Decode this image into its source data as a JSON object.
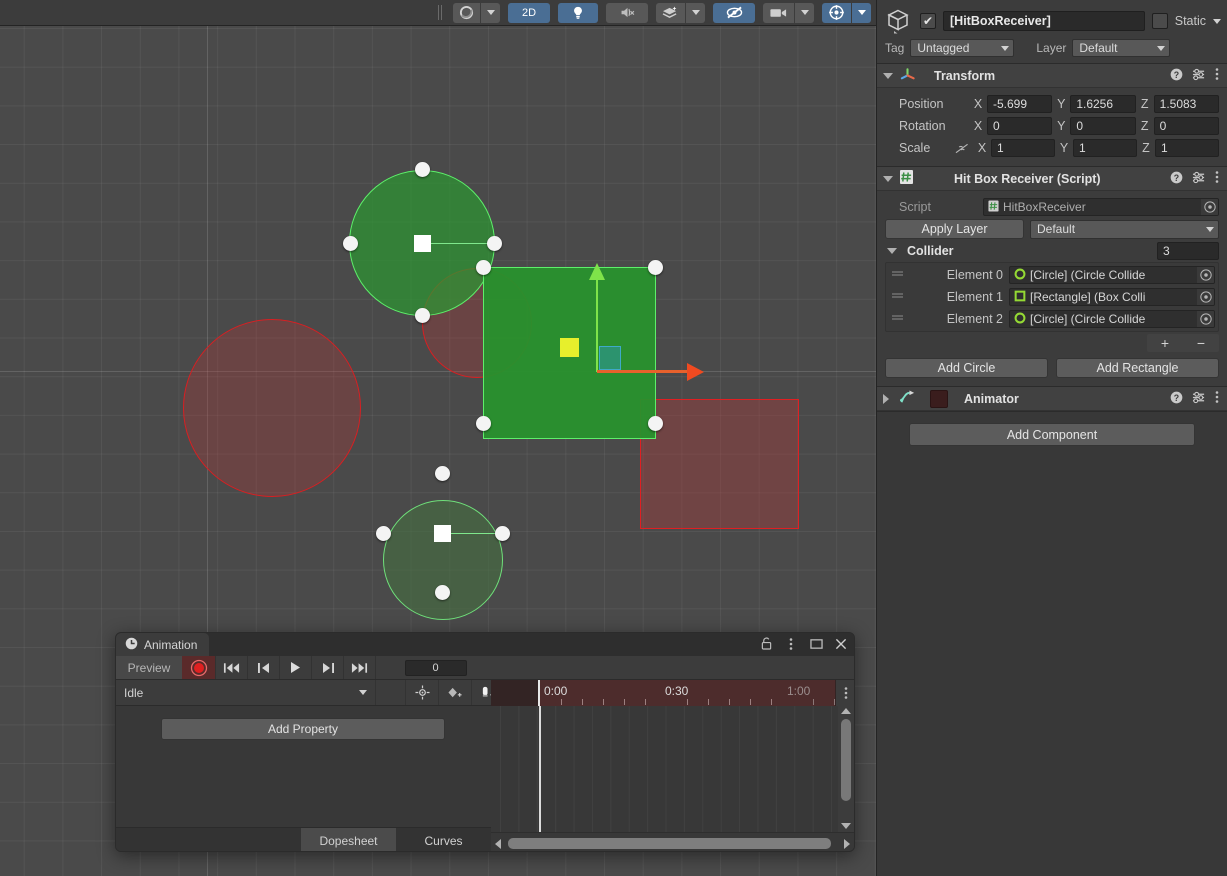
{
  "scene": {
    "toolbar": {
      "draw_mode_label": "",
      "two_d_label": "2D",
      "lighting_icon": "lightbulb-icon",
      "audio_icon": "audio-mute-icon",
      "fx_icon": "effects-icon",
      "hidden_objects_icon": "hidden-objects-icon",
      "camera_icon": "scene-camera-icon",
      "gizmos_icon": "gizmos-icon",
      "shading_icon": "shading-mode-icon"
    },
    "shapes": [
      {
        "name": "circle-collider-top",
        "type": "circle",
        "state": "selected-green"
      },
      {
        "name": "circle-collider-overlap-red",
        "type": "circle",
        "state": "red"
      },
      {
        "name": "rectangle-collider-green",
        "type": "rect",
        "state": "selected-green"
      },
      {
        "name": "circle-collider-left-red",
        "type": "circle",
        "state": "red"
      },
      {
        "name": "circle-collider-bottom",
        "type": "circle",
        "state": "green-dim"
      },
      {
        "name": "rectangle-collider-red",
        "type": "rect",
        "state": "red"
      }
    ]
  },
  "animation": {
    "tab_label": "Animation",
    "tab_icon": "clock-icon",
    "window_icons": [
      "lock-icon",
      "kebab-menu-icon",
      "maximize-icon",
      "close-icon"
    ],
    "preview_label": "Preview",
    "record_icon": "record-icon",
    "transport": [
      "skip-to-start-icon",
      "prev-keyframe-icon",
      "play-icon",
      "next-keyframe-icon",
      "skip-to-end-icon"
    ],
    "frame_value": "0",
    "clip_name": "Idle",
    "row2_buttons": [
      "add-event-icon",
      "add-keyframe-icon",
      "add-keyframe-marker-icon"
    ],
    "add_property_label": "Add Property",
    "bottom_tabs": [
      {
        "label": "Dopesheet",
        "active": true
      },
      {
        "label": "Curves",
        "active": false
      }
    ],
    "timeline_ticks": [
      "0:00",
      "0:30",
      "1:00"
    ],
    "kebab_icon": "timeline-menu-icon",
    "scroll_up_icon": "scroll-up-arrow",
    "scroll_down_icon": "scroll-down-arrow",
    "scroll_left_icon": "scroll-left-arrow",
    "scroll_right_icon": "scroll-right-arrow"
  },
  "inspector": {
    "gameobject": {
      "icon": "cube-icon",
      "enabled": true,
      "check_glyph": "✔",
      "name": "[HitBoxReceiver]",
      "static_label": "Static",
      "tag_label": "Tag",
      "tag_value": "Untagged",
      "layer_label": "Layer",
      "layer_value": "Default"
    },
    "components": [
      {
        "name": "transform",
        "icon": "transform-axis-icon",
        "title": "Transform",
        "expanded": true,
        "header_icons": [
          "help-icon",
          "preset-icon",
          "kebab-menu-icon"
        ],
        "rows": [
          {
            "label": "Position",
            "x": "-5.699",
            "y": "1.6256",
            "z": "1.5083"
          },
          {
            "label": "Rotation",
            "x": "0",
            "y": "0",
            "z": "0"
          },
          {
            "label": "Scale",
            "x": "1",
            "y": "1",
            "z": "1",
            "link_icon": "constrain-proportions-off-icon"
          }
        ],
        "axis_labels": [
          "X",
          "Y",
          "Z"
        ]
      },
      {
        "name": "hit-box-receiver-script",
        "icon": "script-icon",
        "title": "Hit Box Receiver (Script)",
        "expanded": true,
        "header_icons": [
          "help-icon",
          "preset-icon",
          "kebab-menu-icon"
        ],
        "script_label": "Script",
        "script_value": "HitBoxReceiver",
        "apply_layer_label": "Apply Layer",
        "layer_value": "Default",
        "collider_label": "Collider",
        "collider_count": "3",
        "elements": [
          {
            "label": "Element 0",
            "value": "[Circle] (Circle Collide",
            "icon": "circle-collider-icon"
          },
          {
            "label": "Element 1",
            "value": "[Rectangle] (Box Colli",
            "icon": "box-collider-icon"
          },
          {
            "label": "Element 2",
            "value": "[Circle] (Circle Collide",
            "icon": "circle-collider-icon"
          }
        ],
        "list_add_label": "+",
        "list_remove_label": "−",
        "add_circle_label": "Add Circle",
        "add_rectangle_label": "Add Rectangle"
      },
      {
        "name": "animator",
        "icon": "animator-icon",
        "title": "Animator",
        "expanded": false,
        "header_icons": [
          "help-icon",
          "preset-icon",
          "kebab-menu-icon"
        ]
      }
    ],
    "add_component_label": "Add Component"
  },
  "colors": {
    "panel_bg": "#383838",
    "panel_header": "#3c3c3c",
    "scene_bg": "#4a4a4a",
    "accent_blue": "#4a6e94",
    "collider_green": "#2c9131",
    "collider_red": "#c03a3a",
    "record_red": "#e02020",
    "gizmo_green": "#7fe34a",
    "gizmo_red": "#f04a20",
    "gizmo_yellow": "#e7ef2c"
  }
}
